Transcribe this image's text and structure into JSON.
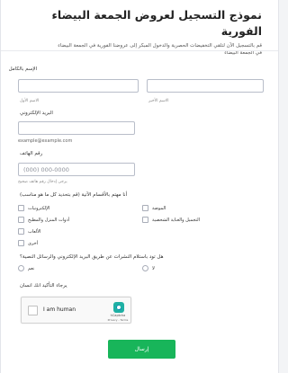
{
  "header": {
    "title": "نموذج التسجيل لعروض الجمعة البيضاء الفورية",
    "subtitle": "قم بالتسجيل الآن لتلقي التخفيضات الحصرية والدخول المبكر إلى عروضنا الفورية في الجمعة البيضاء",
    "place": "في الجمعة البيضاء"
  },
  "name": {
    "label": "الإسم بالكامل",
    "first_sub": "الاسم الأول",
    "last_sub": "الاسم الأخير",
    "first_value": "",
    "last_value": ""
  },
  "email": {
    "label": "البريد الإلكتروني",
    "value": "",
    "hint": "example@example.com"
  },
  "phone": {
    "label": "رقم الهاتف",
    "placeholder": "(000) 000-0000",
    "hint": "يرجى إدخال رقم هاتف صحيح"
  },
  "interests": {
    "question": "أنا مهتم بالأقسام الآتية (قم بتحديد كل ما هو مناسب)",
    "options": [
      "الإلكترونيات",
      "الموضة",
      "أدوات المنزل والمطبخ",
      "التجميل والعناية الشخصية",
      "الألعاب",
      "أخرى"
    ]
  },
  "newsletter": {
    "question": "هل تود باستلام النشرات عن طريق البريد الإلكتروني والرسائل النصية؟",
    "options": [
      "نعم",
      "لا"
    ]
  },
  "captcha": {
    "label": "يرجاء التأكيد انك انسان",
    "text": "I am human",
    "brand": "hCaptcha",
    "terms": "Privacy - Terms"
  },
  "submit": {
    "label": "إرسال"
  },
  "colors": {
    "submit": "#18b55a",
    "captcha_logo": "#1fb0a4"
  }
}
